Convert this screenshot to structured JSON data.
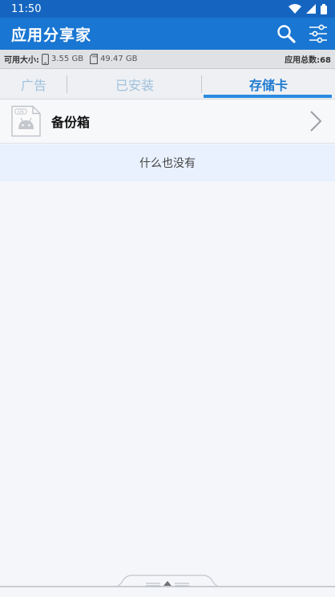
{
  "status_bar": {
    "time": "11:50",
    "icons": [
      "wifi-icon",
      "signal-icon",
      "battery-icon"
    ]
  },
  "app_bar": {
    "title": "应用分享家",
    "icons": [
      "search-icon",
      "filter-settings-icon"
    ]
  },
  "info_bar": {
    "available_label": "可用大小:",
    "phone_storage": "3.55 GB",
    "sd_storage": "49.47 GB",
    "total_label": "应用总数:68"
  },
  "tabs": [
    {
      "label": "广告",
      "selected": false
    },
    {
      "label": "已安装",
      "selected": false
    },
    {
      "label": "存储卡",
      "selected": true
    }
  ],
  "list": {
    "items": [
      {
        "label": "备份箱",
        "icon": "apk-file-icon"
      }
    ],
    "empty_text": "什么也没有"
  },
  "colors": {
    "status_bar": "#1565c0",
    "app_bar": "#1976d2",
    "accent": "#2b8ae0",
    "tab_inactive": "#9fc1dd"
  }
}
